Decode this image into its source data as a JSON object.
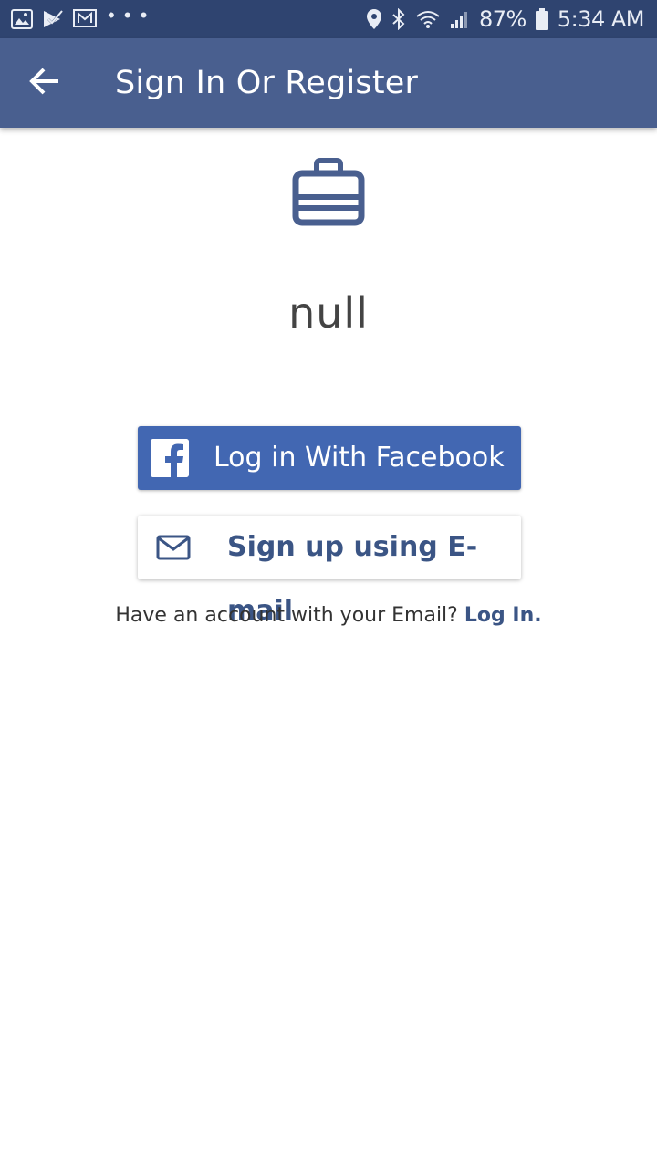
{
  "status_bar": {
    "icons_left": [
      "gallery-icon",
      "clipboard-check-icon",
      "mail-app-icon"
    ],
    "more_dots": "• • •",
    "icons_right": [
      "location-icon",
      "bluetooth-icon",
      "wifi-icon",
      "signal-icon",
      "battery-icon"
    ],
    "battery_percent": "87%",
    "time": "5:34 AM"
  },
  "app_bar": {
    "title": "Sign In Or Register",
    "back_icon": "arrow-left-icon"
  },
  "main": {
    "logo_icon": "briefcase-icon",
    "company_name": "null",
    "facebook_button_label": "Log in With Facebook",
    "email_button_label": "Sign up using E-mail",
    "have_account_text": "Have an account with your Email?",
    "login_link": "Log In."
  },
  "colors": {
    "status_bar": "#2f4470",
    "app_bar": "#495f8f",
    "facebook_blue": "#4267b2",
    "accent_text": "#3b5585"
  }
}
